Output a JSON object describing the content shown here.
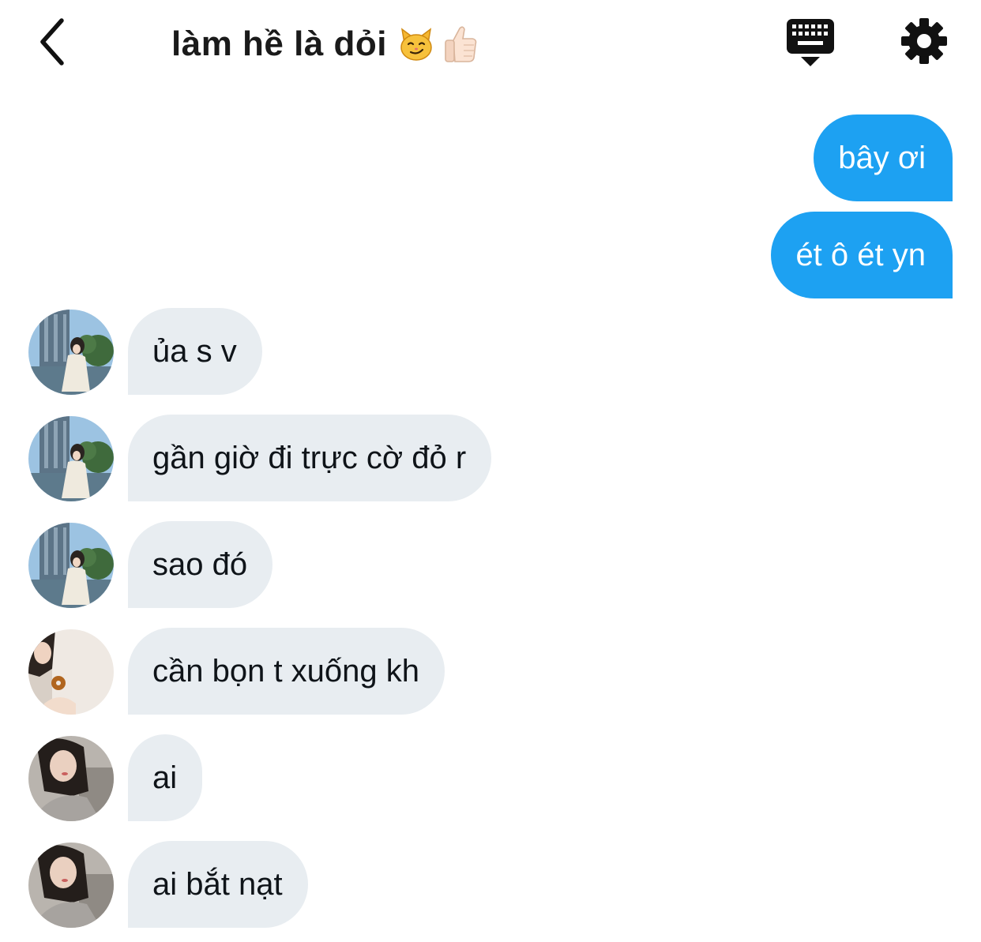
{
  "header": {
    "title": "làm hề là dỏi",
    "title_emojis": [
      "smirking-cat-icon",
      "thumbs-up-icon"
    ],
    "back_icon": "chevron-left-icon",
    "keyboard_icon": "keyboard-icon",
    "settings_icon": "gear-icon"
  },
  "colors": {
    "outgoing_bubble": "#1da1f2",
    "incoming_bubble": "#e8edf1",
    "title_text": "#1a1a1a"
  },
  "messages": [
    {
      "direction": "out",
      "text": "bây ơi"
    },
    {
      "direction": "out",
      "text": "ét ô ét yn"
    },
    {
      "direction": "in",
      "avatar": "avatar-a",
      "text": "ủa s v"
    },
    {
      "direction": "in",
      "avatar": "avatar-a",
      "text": "gần giờ đi trực cờ đỏ r"
    },
    {
      "direction": "in",
      "avatar": "avatar-a",
      "text": "sao đó"
    },
    {
      "direction": "in",
      "avatar": "avatar-b",
      "text": "cần bọn t xuống kh"
    },
    {
      "direction": "in",
      "avatar": "avatar-c",
      "text": "ai"
    },
    {
      "direction": "in",
      "avatar": "avatar-c",
      "text": "ai bắt nạt"
    }
  ]
}
